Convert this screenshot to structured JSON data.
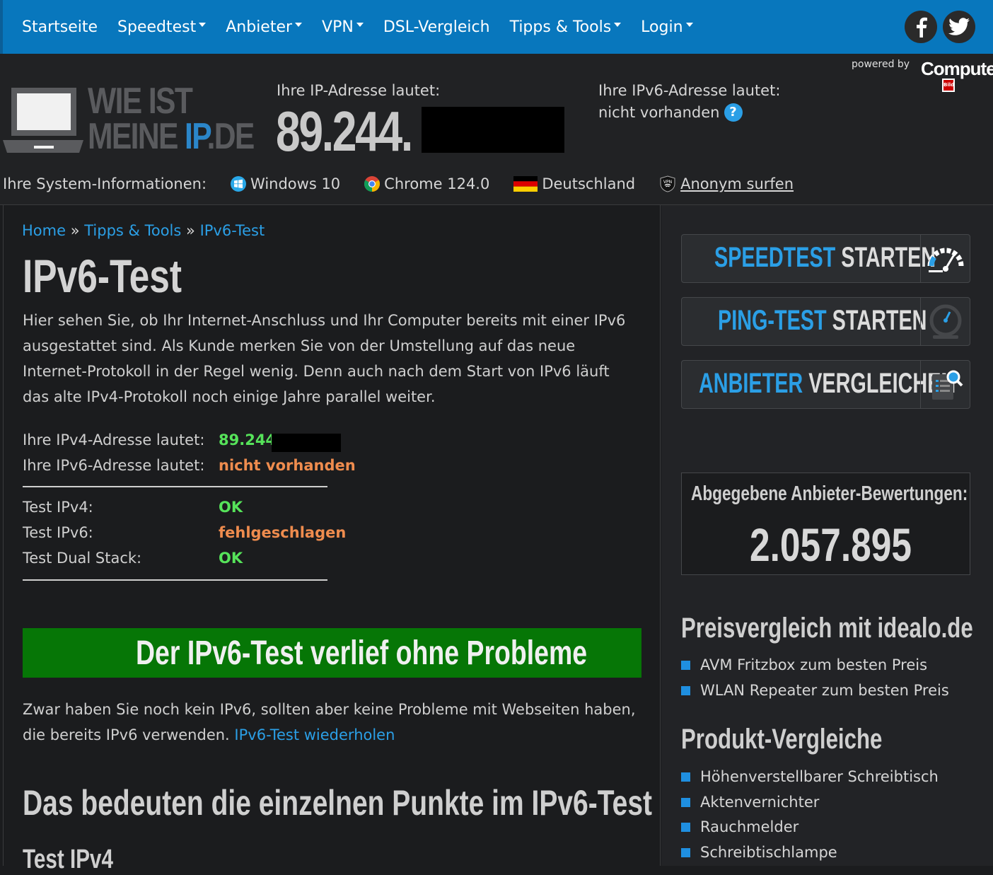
{
  "nav": {
    "items": [
      {
        "label": "Startseite",
        "dropdown": false
      },
      {
        "label": "Speedtest",
        "dropdown": true
      },
      {
        "label": "Anbieter",
        "dropdown": true
      },
      {
        "label": "VPN",
        "dropdown": true
      },
      {
        "label": "DSL-Vergleich",
        "dropdown": false
      },
      {
        "label": "Tipps & Tools",
        "dropdown": true
      },
      {
        "label": "Login",
        "dropdown": true
      }
    ],
    "social": [
      "facebook-icon",
      "twitter-icon"
    ]
  },
  "header": {
    "powered_by": "powered by",
    "partner_logo": "Computer",
    "partner_logo_sub": "Bild",
    "logo_line1": "WIE IST",
    "logo_line2a": "MEINE ",
    "logo_line2b": "IP",
    "logo_line2c": ".DE",
    "ip_label": "Ihre IP-Adresse lautet:",
    "ip_value": "89.244.",
    "ipv6_label": "Ihre IPv6-Adresse lautet:",
    "ipv6_value": "nicht vorhanden",
    "help": "?"
  },
  "system": {
    "label": "Ihre System-Informationen:",
    "os": "Windows 10",
    "browser": "Chrome 124.0",
    "country": "Deutschland",
    "vpn_link": "Anonym surfen"
  },
  "breadcrumb": {
    "home": "Home",
    "sep": "»",
    "tips": "Tipps & Tools",
    "current": "IPv6-Test"
  },
  "page": {
    "title": "IPv6-Test",
    "intro": "Hier sehen Sie, ob Ihr Internet-Anschluss und Ihr Computer bereits mit einer IPv6 ausgestattet sind. Als Kunde merken Sie von der Umstellung auf das neue Internet-Protokoll in der Regel wenig. Denn auch nach dem Start von IPv6 läuft das alte IPv4-Protokoll noch einige Jahre parallel weiter.",
    "ipv4_label": "Ihre IPv4-Adresse lautet:",
    "ipv4_value": "89.244.",
    "ipv6_label": "Ihre IPv6-Adresse lautet:",
    "ipv6_value": "nicht vorhanden",
    "tests": [
      {
        "label": "Test IPv4:",
        "value": "OK",
        "status": "ok"
      },
      {
        "label": "Test IPv6:",
        "value": "fehlgeschlagen",
        "status": "fail"
      },
      {
        "label": "Test Dual Stack:",
        "value": "OK",
        "status": "ok"
      }
    ],
    "banner": "Der IPv6-Test verlief ohne Probleme",
    "result_text": "Zwar haben Sie noch kein IPv6, sollten aber keine Probleme mit Webseiten haben, die bereits IPv6 verwenden.",
    "retry_link": "IPv6-Test wiederholen",
    "h2": "Das bedeuten die einzelnen Punkte im IPv6-Test",
    "h3": "Test IPv4"
  },
  "sidebar": {
    "buttons": [
      {
        "accent": "SPEEDTEST",
        "rest": " STARTEN",
        "icon": "speedometer-icon"
      },
      {
        "accent": "PING-TEST",
        "rest": " STARTEN",
        "icon": "stopwatch-icon"
      },
      {
        "accent": "ANBIETER",
        "rest": " VERGLEICHEN",
        "icon": "list-search-icon"
      }
    ],
    "ratings_label": "Abgegebene Anbieter-Bewertungen:",
    "ratings_value": "2.057.895",
    "idealo_title": "Preisvergleich mit idealo.de",
    "idealo_links": [
      "AVM Fritzbox zum besten Preis",
      "WLAN Repeater zum besten Preis"
    ],
    "products_title": "Produkt-Vergleiche",
    "products": [
      "Höhenverstellbarer Schreibtisch",
      "Aktenvernichter",
      "Rauchmelder",
      "Schreibtischlampe"
    ]
  },
  "colors": {
    "nav": "#0877bd",
    "accent": "#2b9fe6",
    "ok": "#56e35a",
    "fail": "#ef8c4e",
    "banner": "#067606"
  }
}
